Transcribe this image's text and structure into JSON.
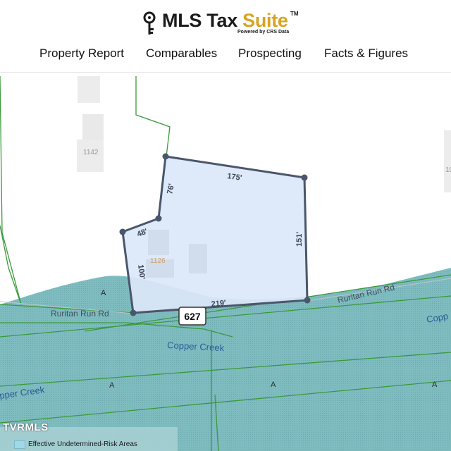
{
  "header": {
    "brand_main": "MLS Tax ",
    "brand_accent": "Suite",
    "trademark": "TM",
    "powered_by": "Powered by CRS Data"
  },
  "nav": {
    "items": [
      {
        "label": "Property Report"
      },
      {
        "label": "Comparables"
      },
      {
        "label": "Prospecting"
      },
      {
        "label": "Facts & Figures"
      }
    ]
  },
  "map": {
    "parcel": {
      "dimensions": [
        "175'",
        "151'",
        "219'",
        "100'",
        "48'",
        "76'"
      ],
      "address_number": "1126"
    },
    "neighbor_address": "1142",
    "partial_address": "10",
    "road_shield": "627",
    "road_labels": [
      "Ruritan Run Rd",
      "Ruritan Run Rd"
    ],
    "creek_labels": [
      "Copper Creek",
      "pper Creek",
      "Copp"
    ],
    "flood_zone_labels": [
      "A",
      "A",
      "A",
      "A"
    ],
    "watermark": "TVRMLS",
    "legend": {
      "label": "Effective Undetermined-Risk Areas",
      "swatch_color": "#9fd8e6"
    },
    "colors": {
      "parcel_fill": "#dbe7f8",
      "parcel_stroke": "#4a566b",
      "flood_fill": "#7fbcc0",
      "parcel_line": "#3a9a3a"
    }
  }
}
